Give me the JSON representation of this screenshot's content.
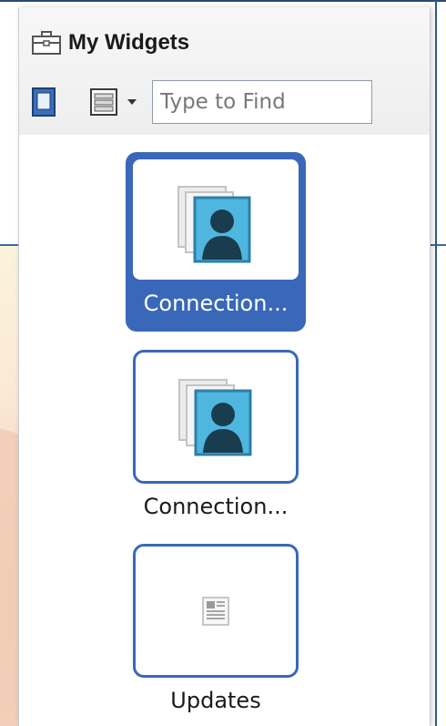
{
  "panel": {
    "title": "My Widgets",
    "title_icon": "briefcase-icon",
    "search": {
      "placeholder": "Type to Find",
      "value": ""
    },
    "view_buttons": [
      "icon-view-icon",
      "list-view-icon",
      "chevron-down-icon"
    ]
  },
  "widgets": [
    {
      "label": "Connection...",
      "icon": "person-card-icon",
      "selected": true
    },
    {
      "label": "Connection...",
      "icon": "person-card-icon",
      "selected": false
    },
    {
      "label": "Updates",
      "icon": "document-icon",
      "selected": false
    }
  ],
  "colors": {
    "accent": "#3a68b8",
    "header_bg": "#f2f2f2",
    "panel_border": "#c9cfd8"
  }
}
